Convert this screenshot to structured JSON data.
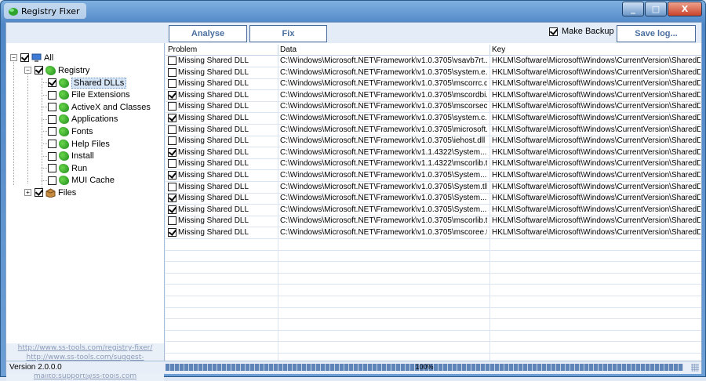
{
  "window": {
    "title": "Registry Fixer",
    "min": "_",
    "max": "□",
    "close": "X"
  },
  "toolbar": {
    "analyse_label": "Analyse",
    "fix_label": "Fix",
    "make_backup_label": "Make Backup",
    "make_backup_checked": true,
    "save_log_label": "Save log..."
  },
  "tree": {
    "root": {
      "label": "All",
      "checked": true,
      "icon": "computer-icon"
    },
    "registry": {
      "label": "Registry",
      "checked": true,
      "icon": "leaf-icon"
    },
    "items": [
      {
        "label": "Shared DLLs",
        "checked": true,
        "selected": true
      },
      {
        "label": "File Extensions",
        "checked": false
      },
      {
        "label": "ActiveX and Classes",
        "checked": false
      },
      {
        "label": "Applications",
        "checked": false
      },
      {
        "label": "Fonts",
        "checked": false
      },
      {
        "label": "Help Files",
        "checked": false
      },
      {
        "label": "Install",
        "checked": false
      },
      {
        "label": "Run",
        "checked": false
      },
      {
        "label": "MUI Cache",
        "checked": false
      }
    ],
    "files": {
      "label": "Files",
      "checked": true,
      "icon": "box-icon"
    }
  },
  "links": [
    "http://www.ss-tools.com/registry-fixer/",
    "http://www.ss-tools.com/suggest-feature.html",
    "mailto:support@ss-tools.com"
  ],
  "grid": {
    "columns": [
      "Problem",
      "Data",
      "Key"
    ],
    "rows": [
      {
        "checked": false,
        "problem": "Missing Shared DLL",
        "data": "C:\\Windows\\Microsoft.NET\\Framework\\v1.0.3705\\vsavb7rt....",
        "key": "HKLM\\Software\\Microsoft\\Windows\\CurrentVersion\\SharedDlls"
      },
      {
        "checked": false,
        "problem": "Missing Shared DLL",
        "data": "C:\\Windows\\Microsoft.NET\\Framework\\v1.0.3705\\system.e...",
        "key": "HKLM\\Software\\Microsoft\\Windows\\CurrentVersion\\SharedDlls"
      },
      {
        "checked": false,
        "problem": "Missing Shared DLL",
        "data": "C:\\Windows\\Microsoft.NET\\Framework\\v1.0.3705\\mscorrc.dll",
        "key": "HKLM\\Software\\Microsoft\\Windows\\CurrentVersion\\SharedDlls"
      },
      {
        "checked": true,
        "problem": "Missing Shared DLL",
        "data": "C:\\Windows\\Microsoft.NET\\Framework\\v1.0.3705\\mscordbi.dll",
        "key": "HKLM\\Software\\Microsoft\\Windows\\CurrentVersion\\SharedDlls"
      },
      {
        "checked": false,
        "problem": "Missing Shared DLL",
        "data": "C:\\Windows\\Microsoft.NET\\Framework\\v1.0.3705\\mscorsec....",
        "key": "HKLM\\Software\\Microsoft\\Windows\\CurrentVersion\\SharedDlls"
      },
      {
        "checked": true,
        "problem": "Missing Shared DLL",
        "data": "C:\\Windows\\Microsoft.NET\\Framework\\v1.0.3705\\system.c...",
        "key": "HKLM\\Software\\Microsoft\\Windows\\CurrentVersion\\SharedDlls"
      },
      {
        "checked": false,
        "problem": "Missing Shared DLL",
        "data": "C:\\Windows\\Microsoft.NET\\Framework\\v1.0.3705\\microsoft....",
        "key": "HKLM\\Software\\Microsoft\\Windows\\CurrentVersion\\SharedDlls"
      },
      {
        "checked": false,
        "problem": "Missing Shared DLL",
        "data": "C:\\Windows\\Microsoft.NET\\Framework\\v1.0.3705\\iehost.dll",
        "key": "HKLM\\Software\\Microsoft\\Windows\\CurrentVersion\\SharedDlls"
      },
      {
        "checked": true,
        "problem": "Missing Shared DLL",
        "data": "C:\\Windows\\Microsoft.NET\\Framework\\v1.1.4322\\System....",
        "key": "HKLM\\Software\\Microsoft\\Windows\\CurrentVersion\\SharedDlls"
      },
      {
        "checked": false,
        "problem": "Missing Shared DLL",
        "data": "C:\\Windows\\Microsoft.NET\\Framework\\v1.1.4322\\mscorlib.tlb",
        "key": "HKLM\\Software\\Microsoft\\Windows\\CurrentVersion\\SharedDlls"
      },
      {
        "checked": true,
        "problem": "Missing Shared DLL",
        "data": "C:\\Windows\\Microsoft.NET\\Framework\\v1.0.3705\\System....",
        "key": "HKLM\\Software\\Microsoft\\Windows\\CurrentVersion\\SharedDlls"
      },
      {
        "checked": false,
        "problem": "Missing Shared DLL",
        "data": "C:\\Windows\\Microsoft.NET\\Framework\\v1.0.3705\\System.tlb",
        "key": "HKLM\\Software\\Microsoft\\Windows\\CurrentVersion\\SharedDlls"
      },
      {
        "checked": true,
        "problem": "Missing Shared DLL",
        "data": "C:\\Windows\\Microsoft.NET\\Framework\\v1.0.3705\\System....",
        "key": "HKLM\\Software\\Microsoft\\Windows\\CurrentVersion\\SharedDlls"
      },
      {
        "checked": true,
        "problem": "Missing Shared DLL",
        "data": "C:\\Windows\\Microsoft.NET\\Framework\\v1.0.3705\\System....",
        "key": "HKLM\\Software\\Microsoft\\Windows\\CurrentVersion\\SharedDlls"
      },
      {
        "checked": false,
        "problem": "Missing Shared DLL",
        "data": "C:\\Windows\\Microsoft.NET\\Framework\\v1.0.3705\\mscorlib.tlb",
        "key": "HKLM\\Software\\Microsoft\\Windows\\CurrentVersion\\SharedDlls"
      },
      {
        "checked": true,
        "problem": "Missing Shared DLL",
        "data": "C:\\Windows\\Microsoft.NET\\Framework\\v1.0.3705\\mscoree.tlb",
        "key": "HKLM\\Software\\Microsoft\\Windows\\CurrentVersion\\SharedDlls"
      }
    ]
  },
  "status": {
    "version": "Version 2.0.0.0",
    "progress_percent": 100,
    "progress_label": "100%"
  }
}
